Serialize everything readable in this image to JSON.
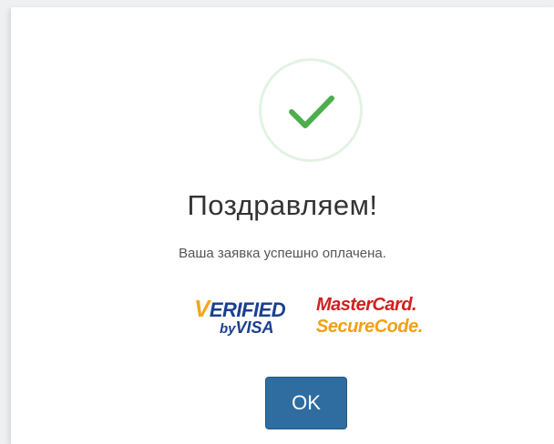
{
  "dialog": {
    "title": "Поздравляем!",
    "message": "Ваша заявка успешно оплачена.",
    "ok_label": "OK",
    "success_icon": "check-icon",
    "check_color": "#4cae4c",
    "button_color": "#2f6da0"
  },
  "badges": {
    "verified_by_visa": {
      "line1_initial": "V",
      "line1_rest": "ERIFIED",
      "line2_by": "by",
      "line2_visa": "VISA"
    },
    "mastercard_securecode": {
      "line1": "MasterCard.",
      "line2": "SecureCode."
    }
  }
}
